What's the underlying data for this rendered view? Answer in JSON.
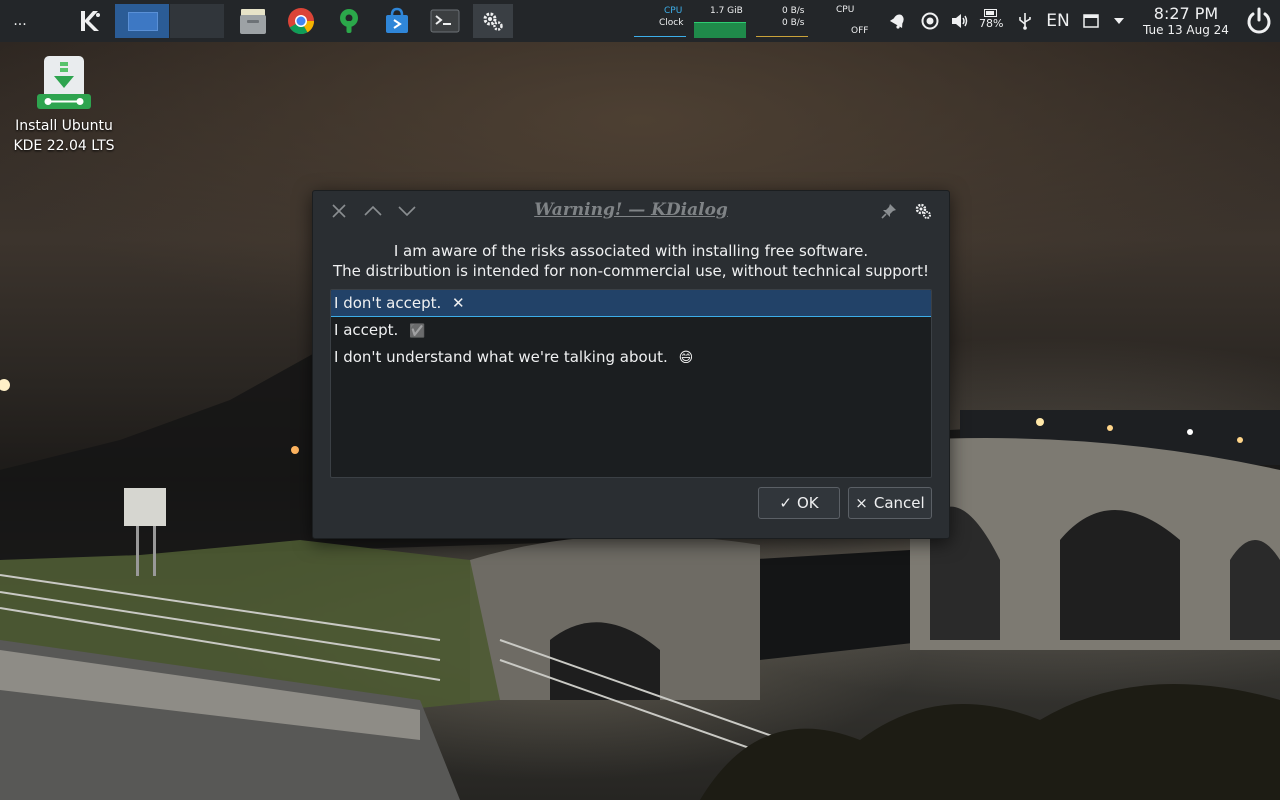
{
  "panel": {
    "overflow_label": "...",
    "monitors": {
      "cpu_label": "CPU",
      "clock_label": "Clock",
      "memory_value": "1.7 GiB",
      "net_up": "0 B/s",
      "net_down": "0 B/s",
      "cpu2_label": "CPU",
      "cpu2_state": "OFF"
    },
    "tray": {
      "battery_percent": "78%",
      "keyboard_layout": "EN"
    },
    "clock": {
      "time": "8:27 PM",
      "date": "Tue 13 Aug 24"
    }
  },
  "desktop": {
    "icon_label_line1": "Install Ubuntu",
    "icon_label_line2": "KDE 22.04 LTS"
  },
  "dialog": {
    "title": "Warning! — KDialog",
    "message_line1": "I am aware of the risks associated with installing free software.",
    "message_line2": "The distribution is intended for non-commercial use, without technical support!",
    "options": [
      {
        "label": "I don't accept.",
        "glyph": "✕"
      },
      {
        "label": "I accept.",
        "glyph": "✅"
      },
      {
        "label": "I don't understand what we're talking about.",
        "glyph": "😄"
      }
    ],
    "ok_label": "OK",
    "ok_glyph": "✓",
    "cancel_label": "Cancel",
    "cancel_glyph": "×"
  },
  "colors": {
    "panel_bg": "#232629",
    "dialog_bg": "#2a2e32",
    "selection": "#224268",
    "accent": "#3daee9"
  }
}
